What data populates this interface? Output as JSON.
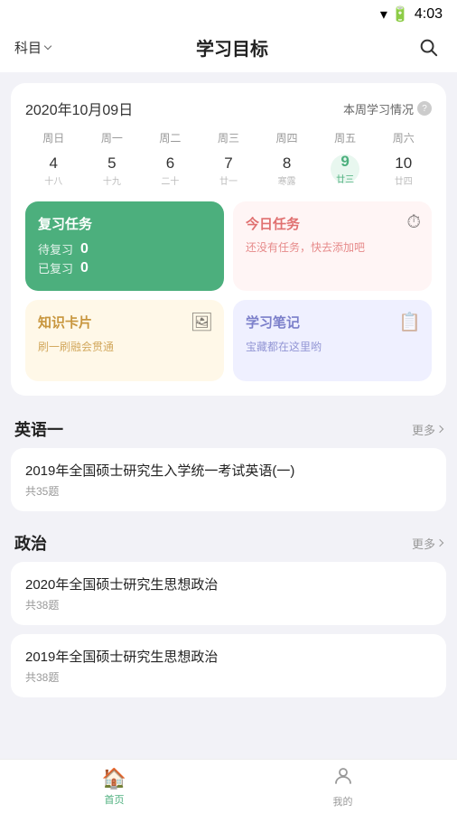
{
  "statusBar": {
    "time": "4:03"
  },
  "topNav": {
    "subjectLabel": "科目",
    "title": "学习目标",
    "searchAriaLabel": "搜索"
  },
  "calendar": {
    "date": "2020年10月09日",
    "weeklyStatus": "本周学习情况",
    "weekHeaders": [
      "周日",
      "周一",
      "周二",
      "周三",
      "周四",
      "周五",
      "周六"
    ],
    "days": [
      {
        "number": "4",
        "lunar": "十八",
        "dot": ""
      },
      {
        "number": "5",
        "lunar": "十九",
        "dot": ""
      },
      {
        "number": "6",
        "lunar": "二十",
        "dot": ""
      },
      {
        "number": "7",
        "lunar": "廿一",
        "dot": ""
      },
      {
        "number": "8",
        "lunar": "寒露",
        "dot": ""
      },
      {
        "number": "9",
        "lunar": "廿三",
        "dot": "",
        "today": true
      },
      {
        "number": "10",
        "lunar": "廿四",
        "dot": ""
      }
    ]
  },
  "reviewCard": {
    "title": "复习任务",
    "pendingLabel": "待复习",
    "pendingCount": "0",
    "doneLabel": "已复习",
    "doneCount": "0"
  },
  "todayCard": {
    "title": "今日任务",
    "emptyText": "还没有任务，快去添加吧"
  },
  "knowledgeCard": {
    "title": "知识卡片",
    "subText": "刷一刷融会贯通"
  },
  "notesCard": {
    "title": "学习笔记",
    "subText": "宝藏都在这里哟"
  },
  "sections": [
    {
      "title": "英语一",
      "moreLabel": "更多",
      "items": [
        {
          "title": "2019年全国硕士研究生入学统一考试英语(一)",
          "sub": "共35题"
        }
      ]
    },
    {
      "title": "政治",
      "moreLabel": "更多",
      "items": [
        {
          "title": "2020年全国硕士研究生思想政治",
          "sub": "共38题"
        },
        {
          "title": "2019年全国硕士研究生思想政治",
          "sub": "共38题"
        }
      ]
    }
  ],
  "bottomNav": {
    "items": [
      {
        "label": "首页",
        "icon": "🏠",
        "active": true
      },
      {
        "label": "我的",
        "icon": "👤",
        "active": false
      }
    ]
  }
}
